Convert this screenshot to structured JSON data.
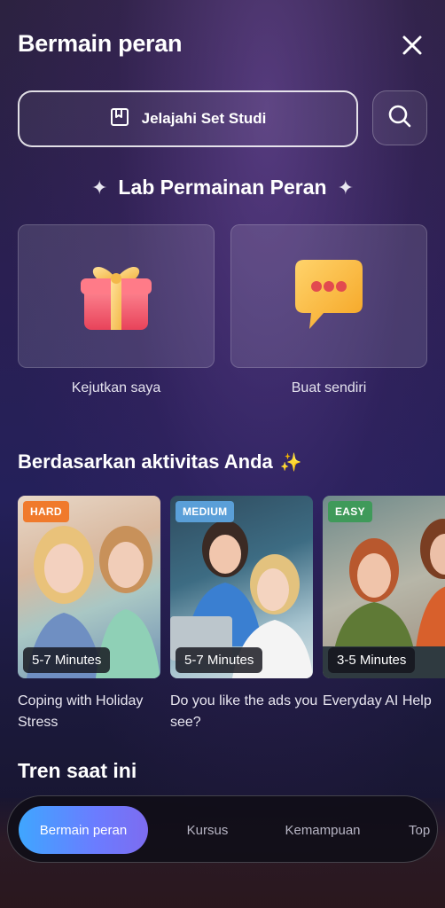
{
  "header": {
    "title": "Bermain peran",
    "close_icon": "close-icon"
  },
  "explore": {
    "label": "Jelajahi Set Studi",
    "icon": "bookmark-icon",
    "search_icon": "search-icon"
  },
  "lab": {
    "title": "Lab Permainan Peran",
    "spark": "✦",
    "cards": [
      {
        "label": "Kejutkan saya",
        "icon": "gift-icon"
      },
      {
        "label": "Buat sendiri",
        "icon": "chat-bubble-icon"
      }
    ]
  },
  "activity": {
    "title": "Berdasarkan aktivitas Anda",
    "sparkle": "✨",
    "cards": [
      {
        "badge": "HARD",
        "badge_color": "#f07a2c",
        "duration": "5-7 Minutes",
        "caption": "Coping with Holiday Stress"
      },
      {
        "badge": "MEDIUM",
        "badge_color": "#5a9fd8",
        "duration": "5-7 Minutes",
        "caption": "Do you like the ads you see?"
      },
      {
        "badge": "EASY",
        "badge_color": "#3f9a5a",
        "duration": "3-5 Minutes",
        "caption": "Everyday AI Help"
      }
    ]
  },
  "trending": {
    "title": "Tren saat ini"
  },
  "tabs": [
    {
      "label": "Bermain peran",
      "active": true
    },
    {
      "label": "Kursus",
      "active": false
    },
    {
      "label": "Kemampuan",
      "active": false
    },
    {
      "label": "Top",
      "active": false
    }
  ]
}
